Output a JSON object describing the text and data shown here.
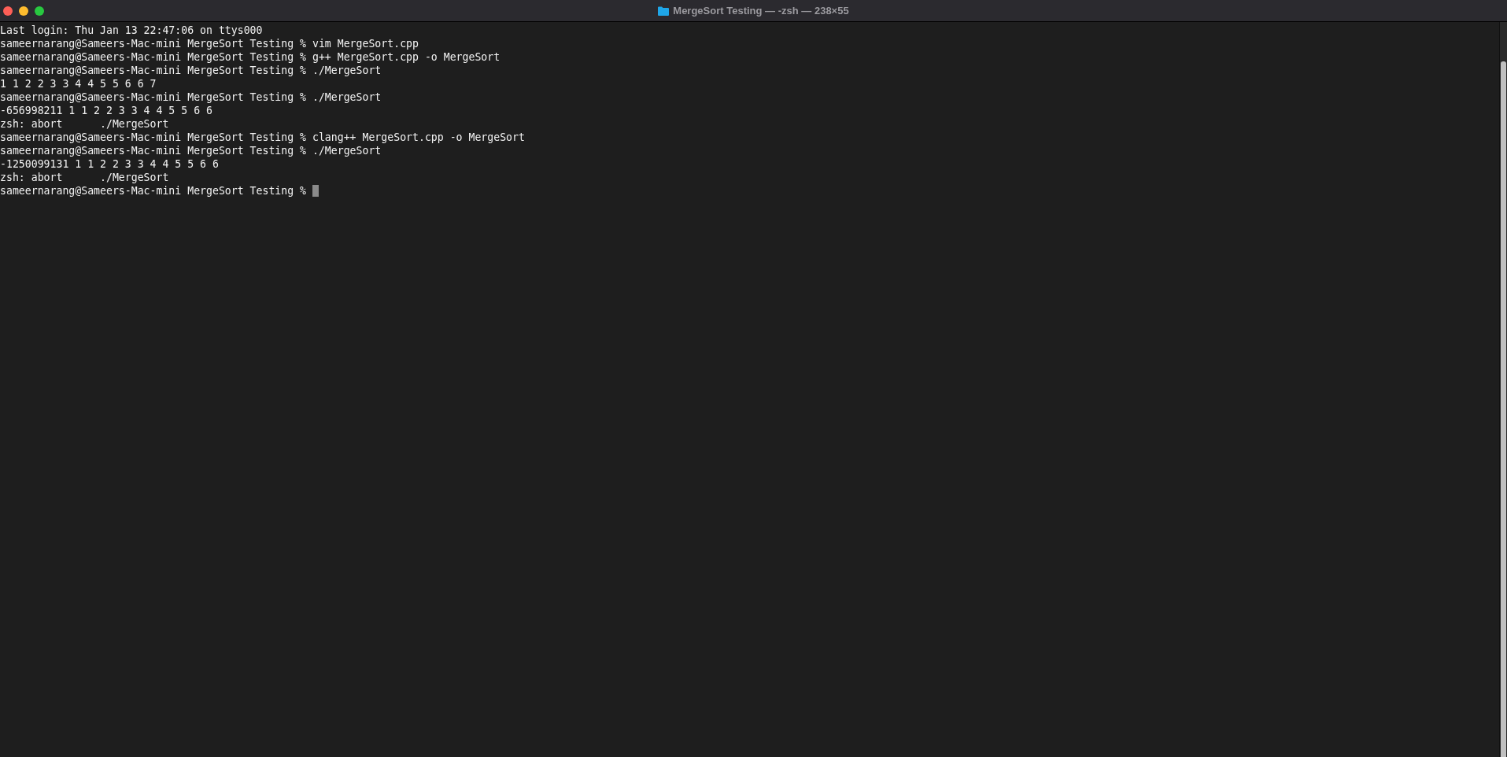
{
  "window": {
    "title": "MergeSort Testing — -zsh — 238×55"
  },
  "lines": [
    "Last login: Thu Jan 13 22:47:06 on ttys000",
    "sameernarang@Sameers-Mac-mini MergeSort Testing % vim MergeSort.cpp",
    "sameernarang@Sameers-Mac-mini MergeSort Testing % g++ MergeSort.cpp -o MergeSort",
    "sameernarang@Sameers-Mac-mini MergeSort Testing % ./MergeSort",
    "1 1 2 2 3 3 4 4 5 5 6 6 7",
    "sameernarang@Sameers-Mac-mini MergeSort Testing % ./MergeSort",
    "-656998211 1 1 2 2 3 3 4 4 5 5 6 6",
    "zsh: abort      ./MergeSort",
    "sameernarang@Sameers-Mac-mini MergeSort Testing % clang++ MergeSort.cpp -o MergeSort",
    "sameernarang@Sameers-Mac-mini MergeSort Testing % ./MergeSort",
    "-1250099131 1 1 2 2 3 3 4 4 5 5 6 6",
    "zsh: abort      ./MergeSort"
  ],
  "prompt": "sameernarang@Sameers-Mac-mini MergeSort Testing % "
}
